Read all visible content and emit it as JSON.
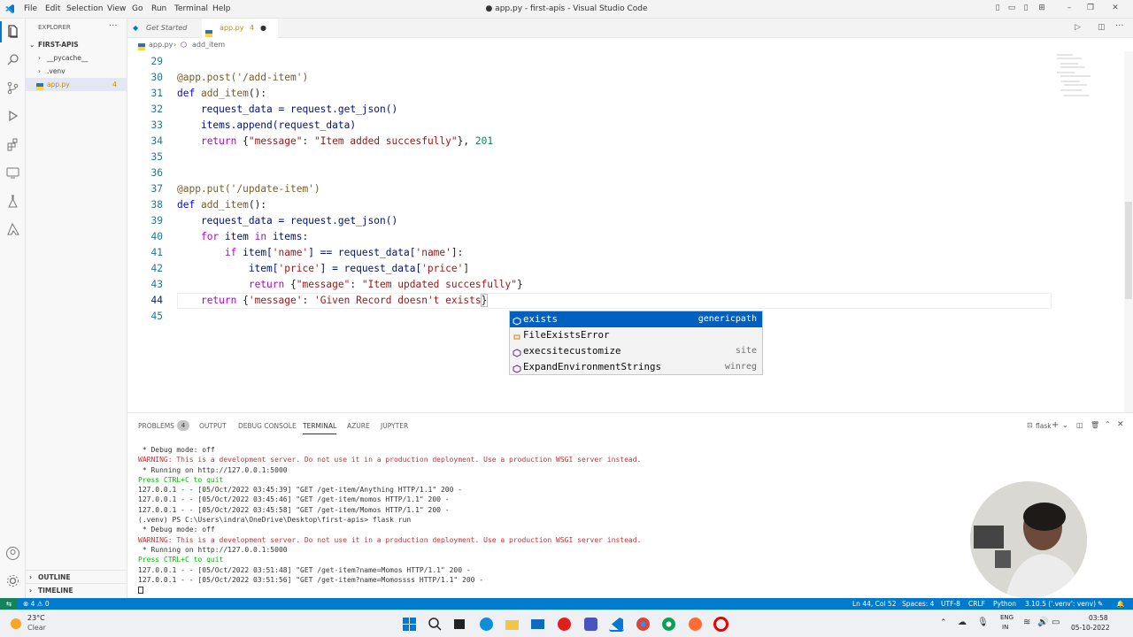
{
  "titlebar": {
    "menus": [
      "File",
      "Edit",
      "Selection",
      "View",
      "Go",
      "Run",
      "Terminal",
      "Help"
    ],
    "title": "● app.py - first-apis - Visual Studio Code"
  },
  "sidebar": {
    "header": "EXPLORER",
    "folder": "FIRST-APIS",
    "items": [
      {
        "label": "__pycache__"
      },
      {
        "label": ".venv"
      },
      {
        "label": "app.py",
        "badge": "4"
      }
    ],
    "outline": "OUTLINE",
    "timeline": "TIMELINE"
  },
  "tabs": [
    {
      "label": "Get Started"
    },
    {
      "label": "app.py",
      "badge": "4"
    }
  ],
  "breadcrumb": {
    "file": "app.py",
    "symbol": "add_item"
  },
  "editor": {
    "lines": [
      {
        "n": "29"
      },
      {
        "n": "30"
      },
      {
        "n": "31"
      },
      {
        "n": "32"
      },
      {
        "n": "33"
      },
      {
        "n": "34"
      },
      {
        "n": "35"
      },
      {
        "n": "36"
      },
      {
        "n": "37"
      },
      {
        "n": "38"
      },
      {
        "n": "39"
      },
      {
        "n": "40"
      },
      {
        "n": "41"
      },
      {
        "n": "42"
      },
      {
        "n": "43"
      },
      {
        "n": "44"
      },
      {
        "n": "45"
      }
    ],
    "code": {
      "l30": "@app.post('/add-item')",
      "l31a": "def ",
      "l31b": "add_item",
      "l31c": "():",
      "l32": "    request_data = request.get_json()",
      "l33": "    items.append(request_data)",
      "l34a": "    ",
      "l34b": "return",
      "l34c": " {",
      "l34d": "\"message\"",
      "l34e": ": ",
      "l34f": "\"Item added succesfully\"",
      "l34g": "}, ",
      "l34h": "201",
      "l37": "@app.put('/update-item')",
      "l38a": "def ",
      "l38b": "add_item",
      "l38c": "():",
      "l39": "    request_data = request.get_json()",
      "l40a": "    ",
      "l40b": "for",
      "l40c": " item ",
      "l40d": "in",
      "l40e": " items:",
      "l41a": "        ",
      "l41b": "if",
      "l41c": " item[",
      "l41d": "'name'",
      "l41e": "] == request_data[",
      "l41f": "'name'",
      "l41g": "]:",
      "l42a": "            item[",
      "l42b": "'price'",
      "l42c": "] = request_data[",
      "l42d": "'price'",
      "l42e": "]",
      "l43a": "            ",
      "l43b": "return",
      "l43c": " {",
      "l43d": "\"message\"",
      "l43e": ": ",
      "l43f": "\"Item updated succesfully\"",
      "l43g": "}",
      "l44a": "    ",
      "l44b": "return",
      "l44c": " {",
      "l44d": "'message'",
      "l44e": ": ",
      "l44f": "'Given Record doesn't exists",
      "l44g": "}"
    }
  },
  "suggest": [
    {
      "label": "exists",
      "detail": "genericpath",
      "icon": "symbol-method-icon"
    },
    {
      "label": "FileExistsError",
      "detail": "",
      "icon": "symbol-class-icon"
    },
    {
      "label": "execsitecustomize",
      "detail": "site",
      "icon": "symbol-method-icon"
    },
    {
      "label": "ExpandEnvironmentStrings",
      "detail": "winreg",
      "icon": "symbol-method-icon"
    }
  ],
  "panel": {
    "tabs": [
      "PROBLEMS",
      "OUTPUT",
      "DEBUG CONSOLE",
      "TERMINAL",
      "AZURE",
      "JUPYTER"
    ],
    "problems_count": "4",
    "shell": "flask",
    "terminal": [
      " * Debug mode: off",
      "WARNING: This is a development server. Do not use it in a production deployment. Use a production WSGI server instead.",
      " * Running on http://127.0.0.1:5000",
      "Press CTRL+C to quit",
      "127.0.0.1 - - [05/Oct/2022 03:45:39] \"GET /get-item/Anything HTTP/1.1\" 200 -",
      "127.0.0.1 - - [05/Oct/2022 03:45:46] \"GET /get-item/momos HTTP/1.1\" 200 -",
      "127.0.0.1 - - [05/Oct/2022 03:45:58] \"GET /get-item/Momos HTTP/1.1\" 200 -",
      "(.venv) PS C:\\Users\\indra\\OneDrive\\Desktop\\first-apis> flask run",
      " * Debug mode: off",
      "WARNING: This is a development server. Do not use it in a production deployment. Use a production WSGI server instead.",
      " * Running on http://127.0.0.1:5000",
      "Press CTRL+C to quit",
      "127.0.0.1 - - [05/Oct/2022 03:51:48] \"GET /get-item?name=Momos HTTP/1.1\" 200 -",
      "127.0.0.1 - - [05/Oct/2022 03:51:56] \"GET /get-item?name=Momossss HTTP/1.1\" 200 -"
    ]
  },
  "status": {
    "errors": "⊗ 4 ⚠ 0",
    "position": "Ln 44, Col 52",
    "spaces": "Spaces: 4",
    "encoding": "UTF-8",
    "eol": "CRLF",
    "language": "Python",
    "interpreter": "3.10.5 ('.venv': venv)"
  },
  "taskbar": {
    "weather_temp": "23°C",
    "weather_desc": "Clear",
    "lang": "ENG",
    "region": "IN",
    "time": "03:58",
    "date": "05-10-2022"
  },
  "colors": {
    "accent": "#007acc",
    "keyword": "#0000ff",
    "string": "#a31515"
  }
}
